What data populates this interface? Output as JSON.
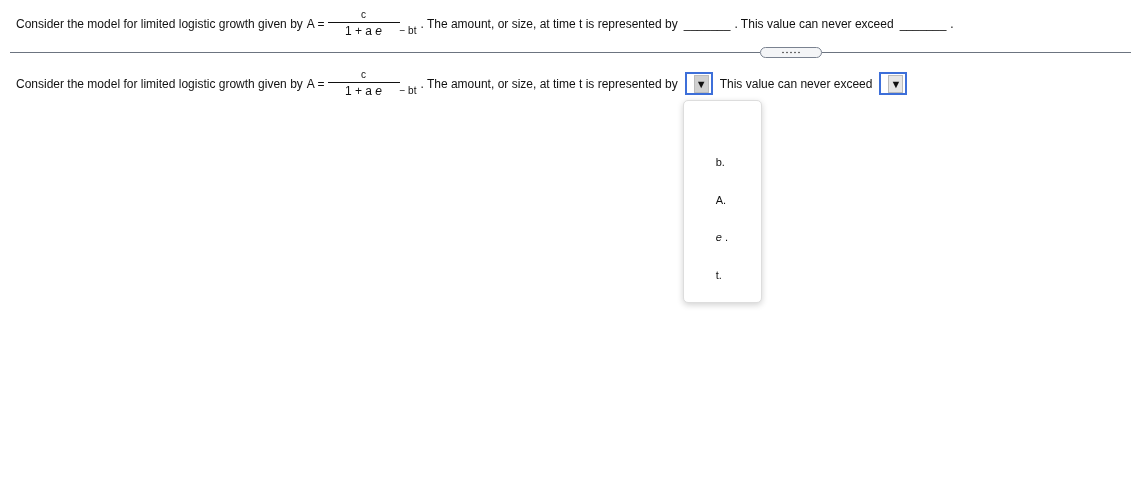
{
  "question": {
    "intro": "Consider the model for limited logistic growth given by",
    "formula": {
      "lhs": "A =",
      "numerator": "c",
      "denominator": "1 + a *e*",
      "exponent": "− bt"
    },
    "after_formula": ". The amount, or size, at time t is represented by",
    "blank_1": "_______",
    "middle": ". This value can never exceed",
    "blank_2": "_______",
    "end": "."
  },
  "answer": {
    "intro": "Consider the model for limited logistic growth given by",
    "formula": {
      "lhs": "A =",
      "numerator": "c",
      "denominator": "1 + a *e*",
      "exponent": "− bt"
    },
    "after_formula": ". The amount, or size, at time t is represented by",
    "middle": "This value can never exceed",
    "dropdowns": [
      {
        "arrow": "▼",
        "expanded": true,
        "focused": true,
        "options": [
          {
            "label": "b.",
            "selected": false
          },
          {
            "label": "A.",
            "selected": false
          },
          {
            "label": "*e* .",
            "selected": false
          },
          {
            "label": "t.",
            "selected": false
          }
        ]
      },
      {
        "arrow": "▼",
        "focused": true
      }
    ]
  }
}
